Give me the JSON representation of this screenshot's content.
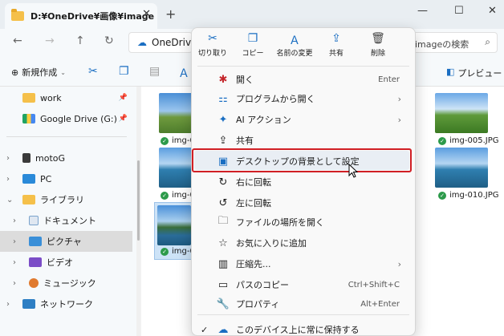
{
  "window": {
    "tab_title": "D:¥OneDrive¥画像¥image",
    "tab_close": "✕",
    "new_tab": "+",
    "minimize": "—",
    "maximize": "☐",
    "close": "✕"
  },
  "address": {
    "location": "OneDrive",
    "search_placeholder": "imageの検索"
  },
  "toolbar": {
    "new_label": "新規作成",
    "preview_label": "プレビュー"
  },
  "sidebar": {
    "items": [
      {
        "label": "work",
        "pinned": true
      },
      {
        "label": "Google Drive (G:)",
        "pinned": true
      },
      {
        "label": "motoG"
      },
      {
        "label": "PC"
      },
      {
        "label": "ライブラリ"
      },
      {
        "label": "ドキュメント"
      },
      {
        "label": "ピクチャ"
      },
      {
        "label": "ビデオ"
      },
      {
        "label": "ミュージック"
      },
      {
        "label": "ネットワーク"
      }
    ]
  },
  "files": [
    {
      "name": "img-0"
    },
    {
      "name": "img-005.JPG"
    },
    {
      "name": "img-0"
    },
    {
      "name": "img-010.JPG"
    },
    {
      "name": "img-0"
    }
  ],
  "context_menu": {
    "quick_actions": [
      {
        "label": "切り取り",
        "icon": "scissors-icon"
      },
      {
        "label": "コピー",
        "icon": "copy-icon"
      },
      {
        "label": "名前の変更",
        "icon": "rename-icon"
      },
      {
        "label": "共有",
        "icon": "share-icon"
      },
      {
        "label": "削除",
        "icon": "trash-icon"
      }
    ],
    "items": [
      {
        "label": "開く",
        "shortcut": "Enter",
        "icon": "open-icon"
      },
      {
        "label": "プログラムから開く",
        "submenu": true,
        "icon": "apps-icon"
      },
      {
        "label": "AI アクション",
        "submenu": true,
        "icon": "sparkle-icon"
      },
      {
        "label": "共有",
        "icon": "share-icon"
      },
      {
        "label": "デスクトップの背景として設定",
        "icon": "wallpaper-icon",
        "highlighted": true
      },
      {
        "label": "右に回転",
        "icon": "rotate-right-icon"
      },
      {
        "label": "左に回転",
        "icon": "rotate-left-icon"
      },
      {
        "label": "ファイルの場所を開く",
        "icon": "folder-icon"
      },
      {
        "label": "お気に入りに追加",
        "icon": "star-icon"
      },
      {
        "label": "圧縮先...",
        "submenu": true,
        "icon": "zip-icon"
      },
      {
        "label": "パスのコピー",
        "shortcut": "Ctrl+Shift+C",
        "icon": "path-copy-icon"
      },
      {
        "label": "プロパティ",
        "shortcut": "Alt+Enter",
        "icon": "wrench-icon"
      },
      {
        "label": "このデバイス上に常に保持する",
        "icon": "cloud-icon",
        "checked": true
      }
    ]
  },
  "colors": {
    "accent": "#1a6ec2",
    "highlight_border": "#d11f25",
    "folder": "#f5c04a"
  }
}
